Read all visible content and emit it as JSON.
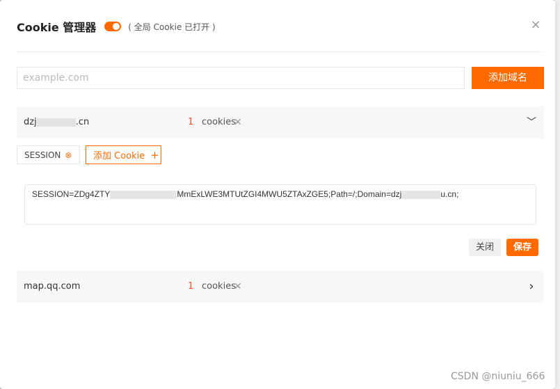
{
  "header": {
    "title": "Cookie 管理器",
    "hint": "( 全局 Cookie 已打开 )",
    "close_glyph": "×",
    "global_enabled": true
  },
  "add_domain": {
    "placeholder": "example.com",
    "value": "",
    "button_label": "添加域名"
  },
  "domains": [
    {
      "name_prefix": "dzj",
      "name_suffix": ".cn",
      "count": "1",
      "count_label": "cookies",
      "remove_glyph": "✕",
      "chevron": "﹀",
      "expanded": true
    },
    {
      "name": "map.qq.com",
      "count": "1",
      "count_label": "cookies",
      "remove_glyph": "✕",
      "chevron": "›",
      "expanded": false
    }
  ],
  "cookie_editor": {
    "chip_label": "SESSION",
    "chip_remove_glyph": "⊗",
    "add_cookie_label": "添加 Cookie",
    "add_cookie_glyph": "+",
    "text_part1": "SESSION=ZDg4ZTY",
    "text_part2": "MmExLWE3MTUtZGI4MWU5ZTAxZGE5;Path=/;Domain=dzj",
    "text_part3": "u.cn;",
    "close_label": "关闭",
    "save_label": "保存"
  },
  "watermark": "CSDN @niuniu_666",
  "colors": {
    "accent": "#ff6a00",
    "count": "#ff4d1a"
  },
  "icons": {
    "toggle": "toggle-switch-icon",
    "close": "close-icon",
    "remove": "remove-x-icon",
    "chip_remove": "circle-x-icon",
    "plus": "plus-icon",
    "expanded": "chevron-down-icon",
    "collapsed": "chevron-right-icon"
  }
}
